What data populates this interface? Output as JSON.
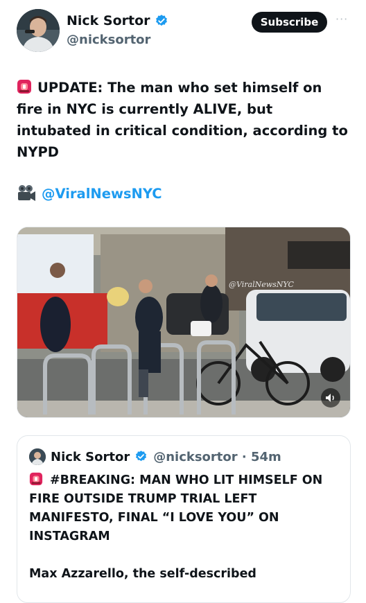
{
  "author": {
    "display_name": "Nick Sortor",
    "handle": "@nicksortor"
  },
  "subscribe_label": "Subscribe",
  "more_label": "···",
  "tweet": {
    "text": "UPDATE: The man who set himself on fire in NYC is currently ALIVE, but intubated in critical condition, according to NYPD",
    "mention": "@ViralNewsNYC"
  },
  "media": {
    "watermark": "@ViralNewsNYC"
  },
  "quote": {
    "display_name": "Nick Sortor",
    "handle_time": "@nicksortor · 54m",
    "text": "#BREAKING: MAN WHO LIT HIMSELF ON FIRE OUTSIDE TRUMP TRIAL LEFT MANIFESTO, FINAL “I LOVE YOU” ON INSTAGRAM",
    "text2": "Max Azzarello, the self-described"
  },
  "colors": {
    "link": "#1d9bf0",
    "verified": "#1d9bf0",
    "button_bg": "#0f1419"
  }
}
